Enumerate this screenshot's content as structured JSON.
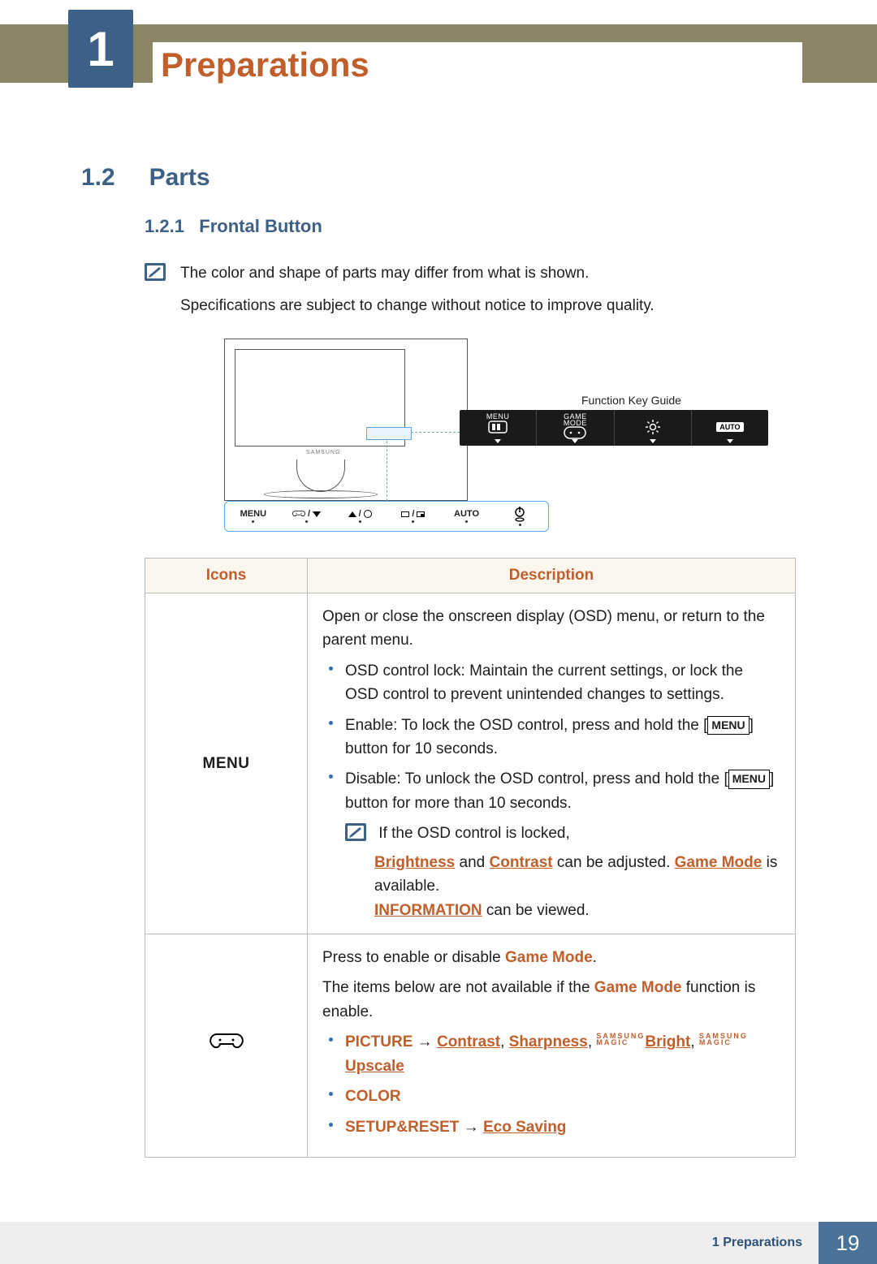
{
  "chapter": {
    "number": "1",
    "title": "Preparations"
  },
  "section": {
    "number": "1.2",
    "title": "Parts"
  },
  "subsection": {
    "number": "1.2.1",
    "title": "Frontal Button"
  },
  "note": {
    "line1": "The color and shape of parts may differ from what is shown.",
    "line2": "Specifications are subject to change without notice to improve quality."
  },
  "figure": {
    "function_key_guide": "Function Key Guide",
    "samsung_label": "SAMSUNG",
    "osd": {
      "menu": "MENU",
      "game_mode_top": "GAME",
      "game_mode_bottom": "MODE",
      "auto": "AUTO"
    },
    "button_bar": {
      "menu": "MENU",
      "auto": "AUTO"
    }
  },
  "table": {
    "headers": {
      "icons": "Icons",
      "description": "Description"
    },
    "row1": {
      "icon_label": "MENU",
      "desc_intro": "Open or close the onscreen display (OSD) menu, or return to the parent menu.",
      "b1": "OSD control lock: Maintain the current settings, or lock the OSD control to prevent unintended changes to settings.",
      "b2_pre": "Enable: To lock the OSD control, press and hold the [",
      "b2_post": "] button for 10 seconds.",
      "b3_pre": "Disable: To unlock the OSD control, press and hold the [",
      "b3_post": "] button for more than 10 seconds.",
      "menu_chip": "MENU",
      "note_line1": "If the OSD control is locked,",
      "note_brightness": "Brightness",
      "note_and": " and ",
      "note_contrast": "Contrast",
      "note_mid": " can be adjusted. ",
      "note_gamemode": "Game Mode",
      "note_tail1": " is available.",
      "note_information": "INFORMATION",
      "note_tail2": " can be viewed."
    },
    "row2": {
      "line1_pre": "Press to enable or disable ",
      "line1_kw": "Game Mode",
      "line1_post": ".",
      "line2_pre": "The items below are not available if the ",
      "line2_kw": "Game Mode",
      "line2_post": " function is enable.",
      "b1_picture": "PICTURE",
      "b1_arrow": "  →  ",
      "b1_contrast": "Contrast",
      "b1_sep": ", ",
      "b1_sharpness": "Sharpness",
      "b1_bright": "Bright",
      "b1_upscale": "Upscale",
      "magic_top": "SAMSUNG",
      "magic_bottom": "MAGIC",
      "b2": "COLOR",
      "b3_setup": "SETUP&RESET",
      "b3_arrow": "  →  ",
      "b3_eco": "Eco Saving"
    }
  },
  "footer": {
    "label": "1 Preparations",
    "page": "19"
  }
}
